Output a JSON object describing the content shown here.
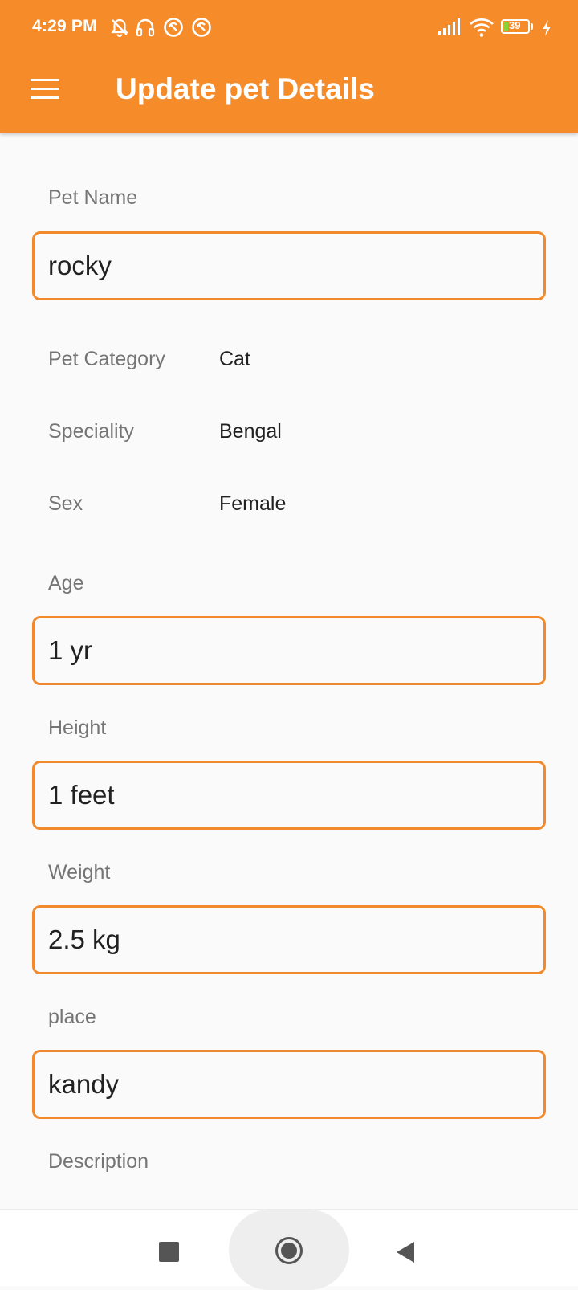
{
  "status_bar": {
    "time": "4:29 PM",
    "battery_level": "39",
    "icons": [
      "muted-alarm-icon",
      "headset-icon",
      "vpn-icon",
      "vpn-icon",
      "signal-icon",
      "wifi-icon",
      "battery-icon",
      "charging-icon"
    ]
  },
  "app_bar": {
    "title": "Update pet Details",
    "menu_icon": "hamburger-menu-icon"
  },
  "form": {
    "pet_name": {
      "label": "Pet Name",
      "value": "rocky"
    },
    "pet_category": {
      "label": "Pet Category",
      "value": "Cat"
    },
    "speciality": {
      "label": "Speciality",
      "value": "Bengal"
    },
    "sex": {
      "label": "Sex",
      "value": "Female"
    },
    "age": {
      "label": "Age",
      "value": "1 yr"
    },
    "height": {
      "label": "Height",
      "value": "1 feet"
    },
    "weight": {
      "label": "Weight",
      "value": "2.5 kg"
    },
    "place": {
      "label": "place",
      "value": "kandy"
    },
    "description": {
      "label": "Description"
    }
  },
  "nav_bar": {
    "recent_icon": "recent-apps-icon",
    "home_icon": "home-icon",
    "back_icon": "back-icon"
  },
  "colors": {
    "primary": "#f68b29",
    "field_border": "#f08a2c",
    "background": "#fafafa"
  }
}
